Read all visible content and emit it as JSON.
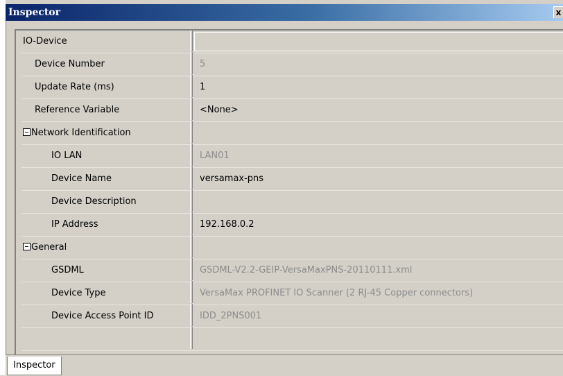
{
  "window": {
    "title": "Inspector",
    "close_glyph": "x"
  },
  "properties": [
    {
      "name": "IO-Device",
      "value": "",
      "indent": 0,
      "expander": false,
      "readonly": false,
      "category": true
    },
    {
      "name": "Device Number",
      "value": "5",
      "indent": 1,
      "expander": false,
      "readonly": true
    },
    {
      "name": "Update Rate (ms)",
      "value": "1",
      "indent": 1,
      "expander": false,
      "readonly": false
    },
    {
      "name": "Reference Variable",
      "value": "<None>",
      "indent": 1,
      "expander": false,
      "readonly": false
    },
    {
      "name": "Network Identification",
      "value": "",
      "indent": 0,
      "expander": true,
      "readonly": false,
      "category": true
    },
    {
      "name": "IO LAN",
      "value": "LAN01",
      "indent": 2,
      "expander": false,
      "readonly": true
    },
    {
      "name": "Device Name",
      "value": "versamax-pns",
      "indent": 2,
      "expander": false,
      "readonly": false
    },
    {
      "name": "Device Description",
      "value": "",
      "indent": 2,
      "expander": false,
      "readonly": false
    },
    {
      "name": "IP Address",
      "value": "192.168.0.2",
      "indent": 2,
      "expander": false,
      "readonly": false
    },
    {
      "name": "General",
      "value": "",
      "indent": 0,
      "expander": true,
      "readonly": false,
      "category": true
    },
    {
      "name": "GSDML",
      "value": "GSDML-V2.2-GEIP-VersaMaxPNS-20110111.xml",
      "indent": 2,
      "expander": false,
      "readonly": true
    },
    {
      "name": "Device Type",
      "value": "VersaMax PROFINET IO Scanner  (2 RJ-45 Copper connectors)",
      "indent": 2,
      "expander": false,
      "readonly": true
    },
    {
      "name": "Device Access Point ID",
      "value": "IDD_2PNS001",
      "indent": 2,
      "expander": false,
      "readonly": true
    },
    {
      "name": "",
      "value": "",
      "indent": 0,
      "expander": false,
      "readonly": false
    }
  ],
  "tabs": [
    {
      "label": "Inspector",
      "active": true
    }
  ]
}
